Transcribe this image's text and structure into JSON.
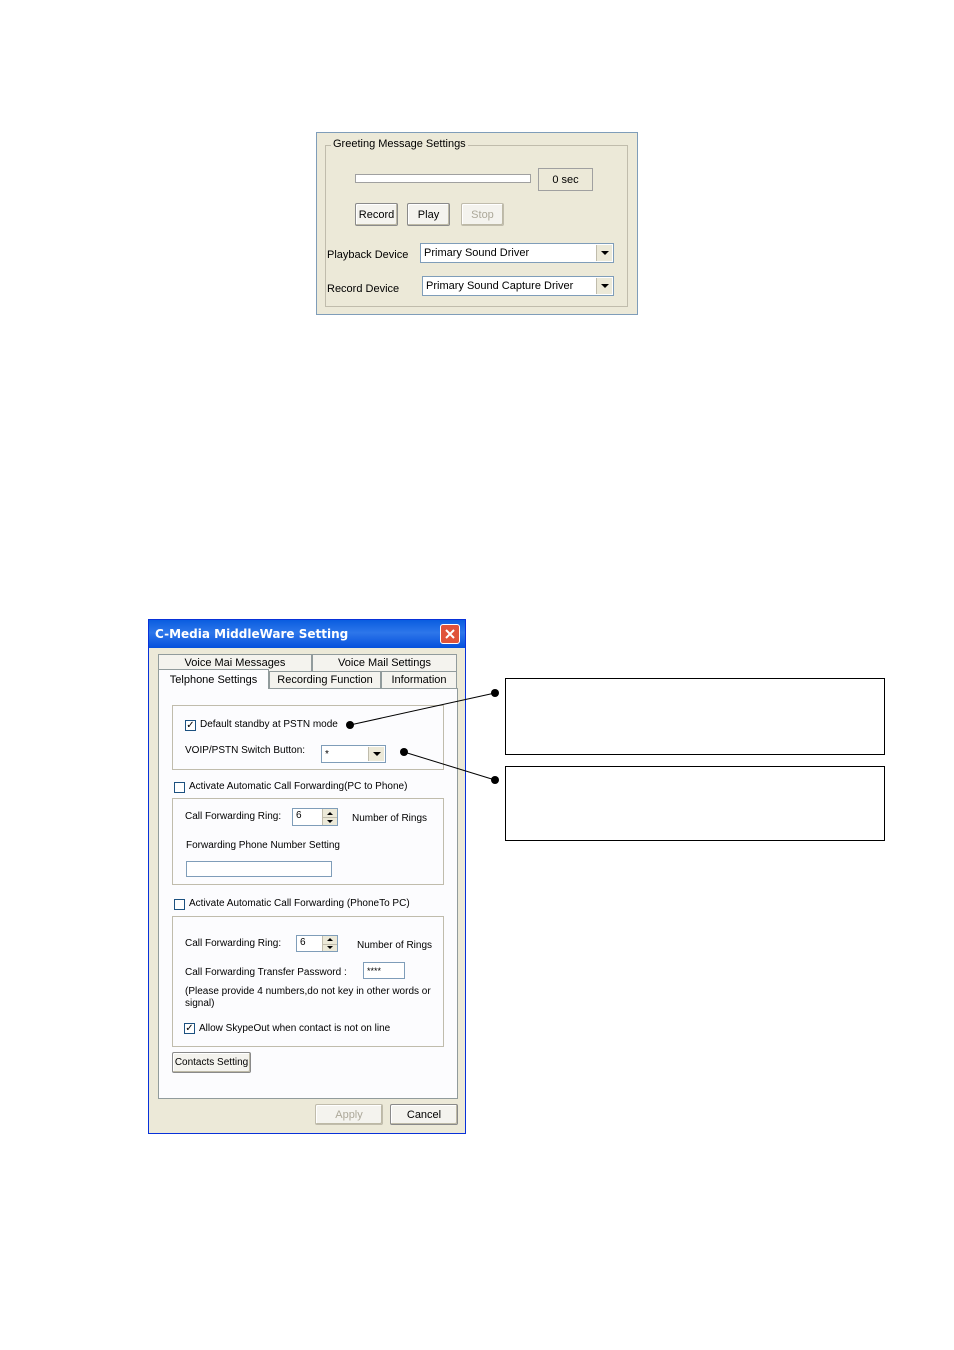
{
  "greeting_panel": {
    "title": "Greeting Message Settings",
    "duration": "0 sec",
    "progress": 0,
    "record_label": "Record",
    "play_label": "Play",
    "stop_label": "Stop",
    "playback_label": "Playback Device",
    "playback_value": "Primary Sound Driver",
    "record_device_label": "Record Device",
    "record_device_value": "Primary Sound Capture Driver"
  },
  "dialog": {
    "title": "C-Media MiddleWare Setting",
    "tabs_row1": [
      "Voice Mai Messages",
      "Voice Mail Settings"
    ],
    "tabs_row2": [
      "Telphone Settings",
      "Recording Function",
      "Information"
    ],
    "active_tab": "Telphone Settings",
    "default_standby_label": "Default standby at PSTN mode",
    "default_standby_checked": true,
    "switch_button_label": "VOIP/PSTN Switch Button:",
    "switch_button_value": "*",
    "pc_to_phone": {
      "label": "Activate Automatic Call Forwarding(PC to Phone)",
      "checked": false,
      "ring_label": "Call Forwarding Ring:",
      "ring_value": "6",
      "rings_unit": "Number of Rings",
      "phone_setting_label": "Forwarding Phone Number Setting",
      "phone_value": ""
    },
    "phone_to_pc": {
      "label": "Activate Automatic Call Forwarding (PhoneTo PC)",
      "checked": false,
      "ring_label": "Call Forwarding Ring:",
      "ring_value": "6",
      "rings_unit": "Number of Rings",
      "password_label": "Call Forwarding Transfer Password :",
      "password_value": "****",
      "note": "(Please provide 4 numbers,do not key in other words or signal)",
      "allow_skypeout_label": "Allow SkypeOut when contact is not on line",
      "allow_skypeout_checked": true
    },
    "contacts_button": "Contacts Setting",
    "apply_label": "Apply",
    "cancel_label": "Cancel"
  },
  "colors": {
    "titlebar_start": "#0a246a",
    "titlebar_end": "#3b6ee8",
    "close_button": "#e0533a",
    "dialog_bg": "#ece9d8"
  },
  "icons": [
    "close-icon",
    "chevron-down-icon",
    "check-icon"
  ]
}
